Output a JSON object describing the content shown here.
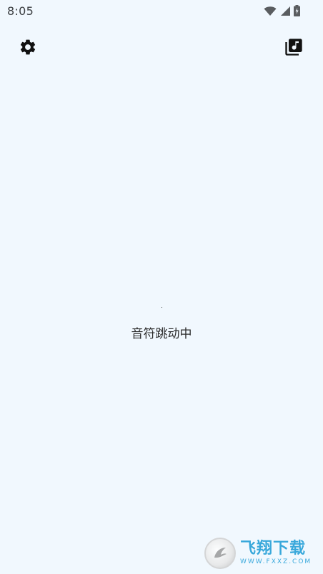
{
  "status_bar": {
    "time": "8:05",
    "icons": [
      "wifi-icon",
      "signal-icon",
      "battery-icon"
    ]
  },
  "toolbar": {
    "left_icon": "settings-icon",
    "right_icon": "music-library-icon"
  },
  "main": {
    "status_text": "音符跳动中"
  },
  "watermark": {
    "title": "飞翔下载",
    "domain": "WWW.FXXZ.COM"
  },
  "colors": {
    "background": "#f1f8fe",
    "icon": "#111111",
    "watermark_accent": "#1a9bd6"
  }
}
